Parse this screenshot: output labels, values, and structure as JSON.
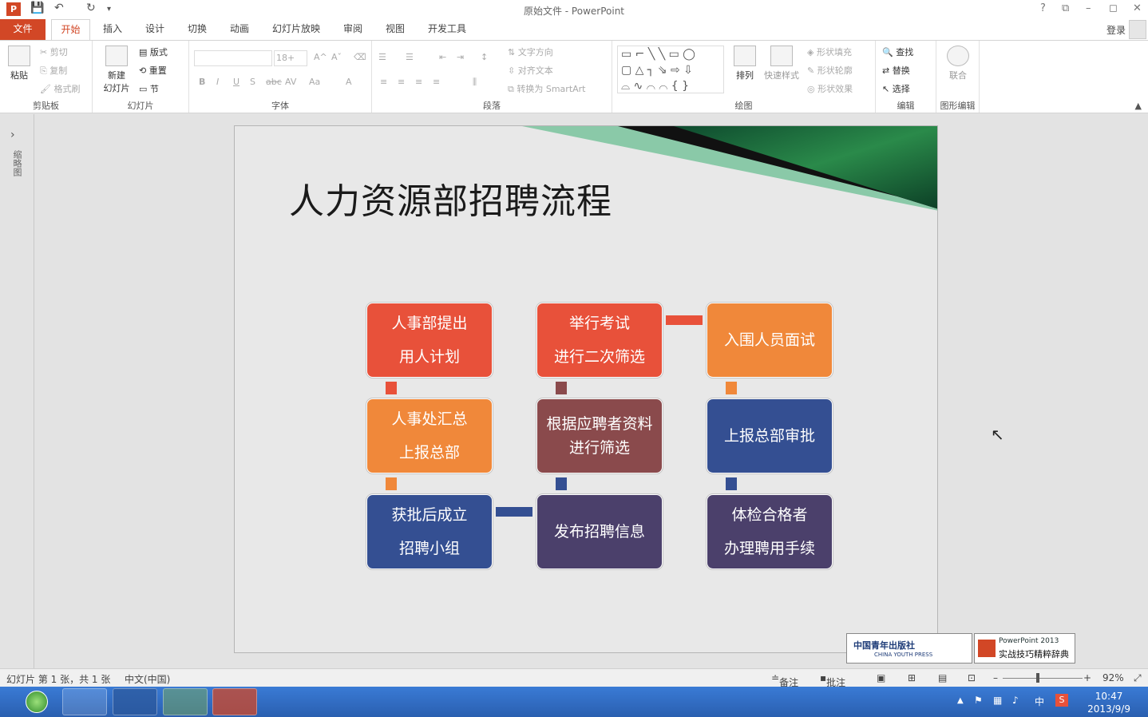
{
  "app": {
    "title": "原始文件 - PowerPoint",
    "logo_text": "P"
  },
  "window_controls": [
    "?",
    "⧉",
    "–",
    "◻",
    "✕"
  ],
  "tabs": [
    "文件",
    "开始",
    "插入",
    "设计",
    "切换",
    "动画",
    "幻灯片放映",
    "审阅",
    "视图",
    "开发工具"
  ],
  "active_tab": "开始",
  "account": {
    "login": "登录"
  },
  "ribbon": {
    "clipboard": {
      "label": "剪贴板",
      "paste": "粘贴",
      "cut": "剪切",
      "copy": "复制",
      "format_painter": "格式刷"
    },
    "slides": {
      "label": "幻灯片",
      "new_slide_1": "新建",
      "new_slide_2": "幻灯片",
      "layout": "版式",
      "reset": "重置",
      "section": "节"
    },
    "font": {
      "label": "字体",
      "size": "18+",
      "bold": "B",
      "italic": "I",
      "underline": "U",
      "shadow": "S",
      "strike": "abc",
      "spacing": "AV",
      "case": "Aa",
      "color": "A"
    },
    "paragraph": {
      "label": "段落",
      "text_dir": "文字方向",
      "align_text": "对齐文本",
      "smartart": "转换为 SmartArt"
    },
    "drawing": {
      "label": "绘图",
      "arrange": "排列",
      "quick_styles": "快速样式",
      "fill": "形状填充",
      "outline": "形状轮廓",
      "effects": "形状效果"
    },
    "editing": {
      "label": "编辑",
      "find": "查找",
      "replace": "替换",
      "select": "选择"
    },
    "shape_edit": {
      "label": "图形编辑",
      "union": "联合"
    }
  },
  "left_pane": {
    "label": "缩略图"
  },
  "slide": {
    "title": "人力资源部招聘流程",
    "boxes": [
      {
        "line1": "人事部提出",
        "line2": "用人计划",
        "color": "#e8513a"
      },
      {
        "line1": "举行考试",
        "line2": "进行二次筛选",
        "color": "#e8513a"
      },
      {
        "line1": "入围人员面试",
        "line2": "",
        "color": "#f0883a"
      },
      {
        "line1": "人事处汇总",
        "line2": "上报总部",
        "color": "#f0883a"
      },
      {
        "line1": "根据应聘者资料",
        "line2": "进行筛选",
        "color": "#8a4a4c"
      },
      {
        "line1": "上报总部审批",
        "line2": "",
        "color": "#344f92"
      },
      {
        "line1": "获批后成立",
        "line2": "招聘小组",
        "color": "#344f92"
      },
      {
        "line1": "发布招聘信息",
        "line2": "",
        "color": "#4b406b"
      },
      {
        "line1": "体检合格者",
        "line2": "办理聘用手续",
        "color": "#4b406b"
      }
    ]
  },
  "watermark": {
    "left_cn": "中国青年出版社",
    "left_en": "CHINA YOUTH PRESS",
    "right_l1": "PowerPoint 2013",
    "right_l2": "实战技巧精粹辞典"
  },
  "status": {
    "slide_info": "幻灯片 第 1 张，共 1 张",
    "language": "中文(中国)",
    "notes": "备注",
    "comments": "批注",
    "zoom": "92%"
  },
  "taskbar": {
    "time": "10:47",
    "date": "2013/9/9",
    "ime": "中"
  }
}
